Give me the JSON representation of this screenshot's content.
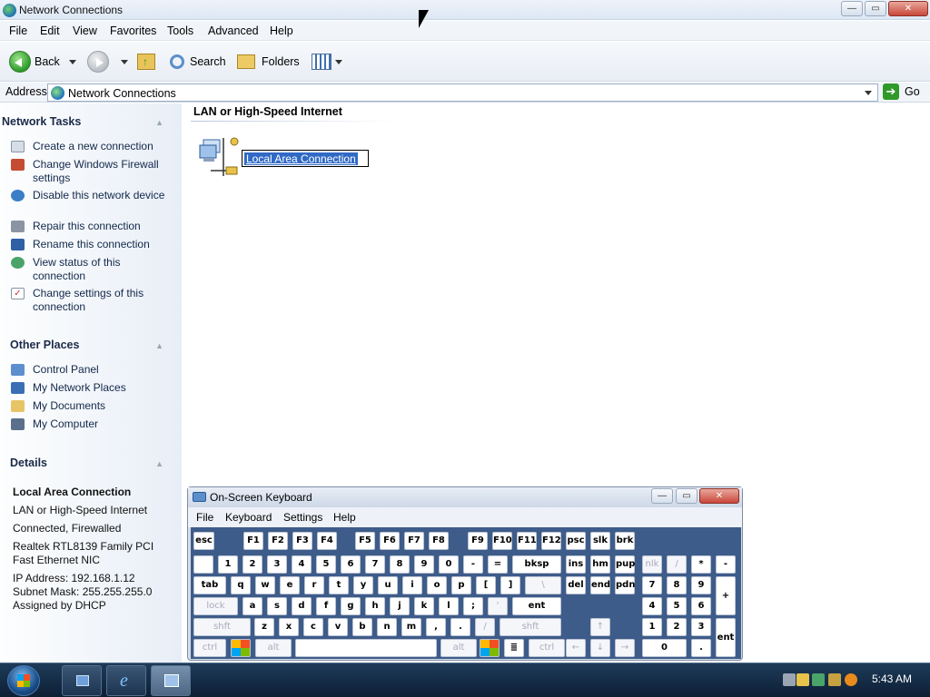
{
  "window": {
    "title": "Network Connections",
    "controls": {
      "minimize": "—",
      "maximize": "▭",
      "close": "✕"
    }
  },
  "menu": [
    "File",
    "Edit",
    "View",
    "Favorites",
    "Tools",
    "Advanced",
    "Help"
  ],
  "toolbar": {
    "back": "Back",
    "search": "Search",
    "folders": "Folders"
  },
  "address": {
    "label": "Address",
    "value": "Network Connections",
    "go": "Go"
  },
  "left_pane": {
    "network_tasks": {
      "title": "Network Tasks",
      "items": [
        "Create a new connection",
        "Change Windows Firewall settings",
        "Disable this network device",
        "Repair this connection",
        "Rename this connection",
        "View status of this connection",
        "Change settings of this connection"
      ]
    },
    "other_places": {
      "title": "Other Places",
      "items": [
        "Control Panel",
        "My Network Places",
        "My Documents",
        "My Computer"
      ]
    },
    "details": {
      "title": "Details",
      "name": "Local Area Connection",
      "type": "LAN or High-Speed Internet",
      "status": "Connected, Firewalled",
      "device": "Realtek RTL8139 Family PCI Fast Ethernet NIC",
      "ip": "IP Address: 192.168.1.12",
      "mask": "Subnet Mask: 255.255.255.0",
      "dhcp": "Assigned by DHCP"
    }
  },
  "main": {
    "group_header": "LAN or High-Speed Internet",
    "connection_name": "Local Area Connection"
  },
  "osk": {
    "title": "On-Screen Keyboard",
    "menu": [
      "File",
      "Keyboard",
      "Settings",
      "Help"
    ],
    "keys": {
      "row1": [
        "esc",
        "F1",
        "F2",
        "F3",
        "F4",
        "F5",
        "F6",
        "F7",
        "F8",
        "F9",
        "F10",
        "F11",
        "F12",
        "psc",
        "slk",
        "brk"
      ],
      "row2": [
        "",
        "1",
        "2",
        "3",
        "4",
        "5",
        "6",
        "7",
        "8",
        "9",
        "0",
        "-",
        "=",
        "bksp",
        "ins",
        "hm",
        "pup",
        "nlk",
        "/",
        "*",
        "-"
      ],
      "row3": [
        "tab",
        "q",
        "w",
        "e",
        "r",
        "t",
        "y",
        "u",
        "i",
        "o",
        "p",
        "[",
        "]",
        "\\",
        "del",
        "end",
        "pdn",
        "7",
        "8",
        "9",
        "+"
      ],
      "row4": [
        "lock",
        "a",
        "s",
        "d",
        "f",
        "g",
        "h",
        "j",
        "k",
        "l",
        ";",
        "'",
        "ent",
        "4",
        "5",
        "6"
      ],
      "row5": [
        "shft",
        "z",
        "x",
        "c",
        "v",
        "b",
        "n",
        "m",
        ",",
        ".",
        "/",
        "shft",
        "↑",
        "1",
        "2",
        "3",
        "ent"
      ],
      "row6": [
        "ctrl",
        "",
        "alt",
        "",
        "alt",
        "",
        "",
        "ctrl",
        "←",
        "↓",
        "→",
        "0",
        "."
      ]
    }
  },
  "taskbar": {
    "clock": "5:43 AM"
  },
  "colors": {
    "accent": "#316ac5",
    "osk_key_bg": "#3e5c8a",
    "taskbar": "#0d1f35"
  }
}
